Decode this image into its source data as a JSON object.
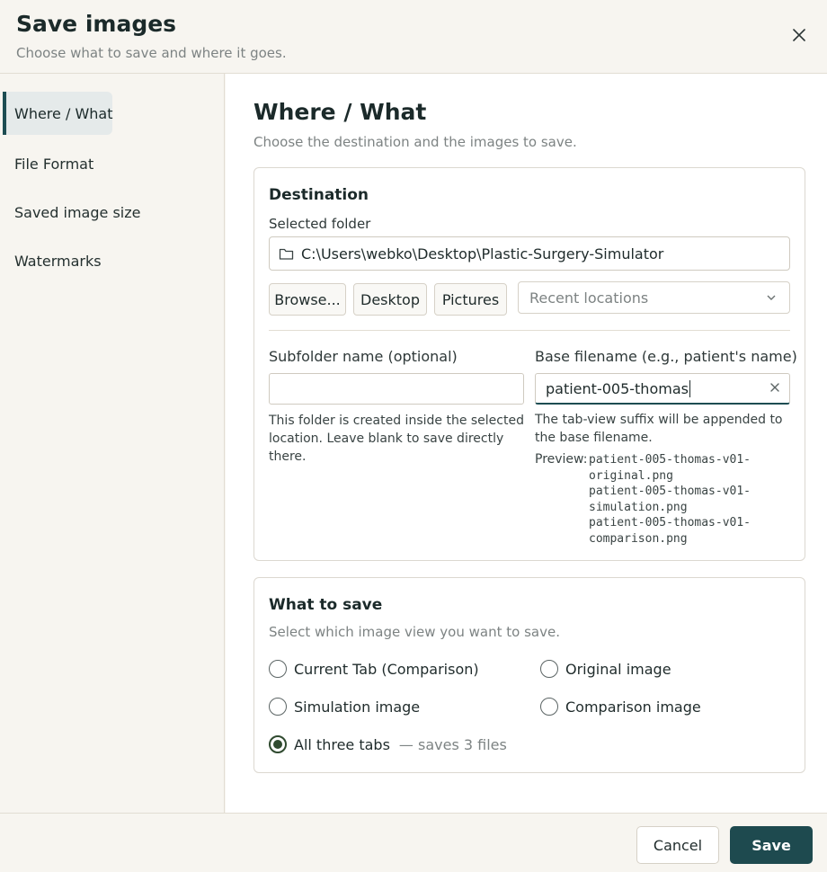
{
  "header": {
    "title": "Save images",
    "subtitle": "Choose what to save and where it goes."
  },
  "sidebar": {
    "items": [
      {
        "label": "Where / What",
        "active": true
      },
      {
        "label": "File Format",
        "active": false
      },
      {
        "label": "Saved image size",
        "active": false
      },
      {
        "label": "Watermarks",
        "active": false
      }
    ]
  },
  "main": {
    "title": "Where / What",
    "subtitle": "Choose the destination and the images to save."
  },
  "destination": {
    "title": "Destination",
    "selected_folder_label": "Selected folder",
    "selected_folder_value": "C:\\Users\\webko\\Desktop\\Plastic-Surgery-Simulator",
    "buttons": {
      "browse": "Browse...",
      "desktop": "Desktop",
      "pictures": "Pictures"
    },
    "recent_locations_placeholder": "Recent locations",
    "subfolder": {
      "label": "Subfolder name (optional)",
      "value": "",
      "help": "This folder is created inside the selected location. Leave blank to save directly there."
    },
    "base_filename": {
      "label": "Base filename (e.g., patient's name)",
      "value": "patient-005-thomas",
      "help": "The tab-view suffix will be appended to the base filename."
    },
    "preview": {
      "label": "Preview:",
      "lines": [
        "patient-005-thomas-v01-",
        "original.png",
        "patient-005-thomas-v01-",
        "simulation.png",
        "patient-005-thomas-v01-",
        "comparison.png"
      ]
    }
  },
  "what_to_save": {
    "title": "What to save",
    "subtitle": "Select which image view you want to save.",
    "options": [
      {
        "label": "Current Tab (Comparison)",
        "checked": false
      },
      {
        "label": "Original image",
        "checked": false
      },
      {
        "label": "Simulation image",
        "checked": false
      },
      {
        "label": "Comparison image",
        "checked": false
      },
      {
        "label": "All three tabs",
        "note": "— saves 3 files",
        "checked": true
      }
    ]
  },
  "footer": {
    "cancel_label": "Cancel",
    "save_label": "Save"
  },
  "colors": {
    "accent": "#1e4a4f",
    "radio_checked": "#2f4a2f",
    "background": "#f7f5f0"
  }
}
